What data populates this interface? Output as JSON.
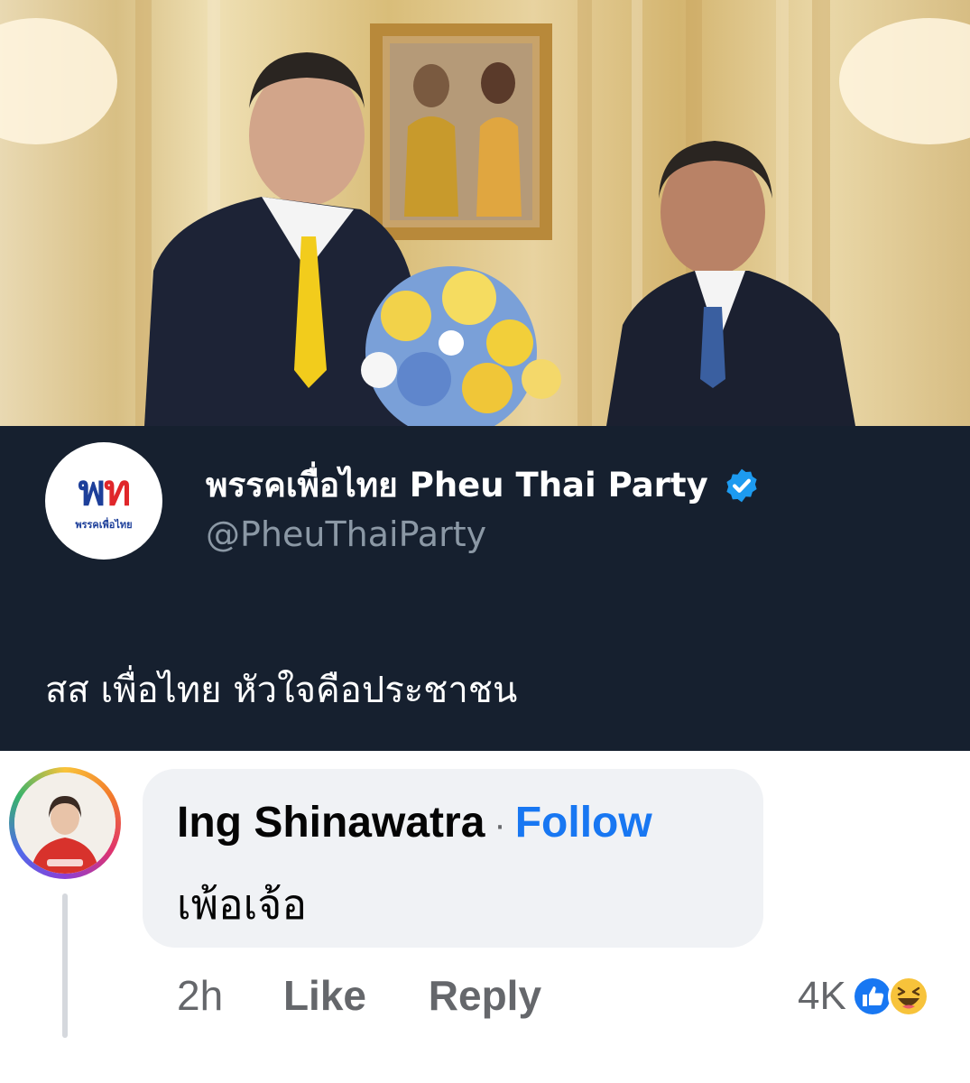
{
  "post": {
    "photo_alt": "",
    "account_name": "พรรคเพื่อไทย Pheu Thai Party",
    "handle": "@PheuThaiParty",
    "logo": {
      "mark_left": "พ",
      "mark_right": "ท",
      "caption": "พรรคเพื่อไทย"
    },
    "verified_icon": "verified-badge-icon",
    "text": "สส เพื่อไทย หัวใจคือประชาชน"
  },
  "comment": {
    "author": "Ing Shinawatra",
    "separator": "·",
    "follow_label": "Follow",
    "text": "เพ้อเจ้อ",
    "time": "2h",
    "like_label": "Like",
    "reply_label": "Reply",
    "reaction_count": "4K",
    "reaction_icons": [
      "like-reaction-icon",
      "haha-reaction-icon"
    ]
  },
  "colors": {
    "tweet_bg": "#16202f",
    "verified_blue": "#1d9bf0",
    "follow_blue": "#1877f2",
    "bubble_bg": "#f0f2f5",
    "muted_text": "#65676b"
  }
}
